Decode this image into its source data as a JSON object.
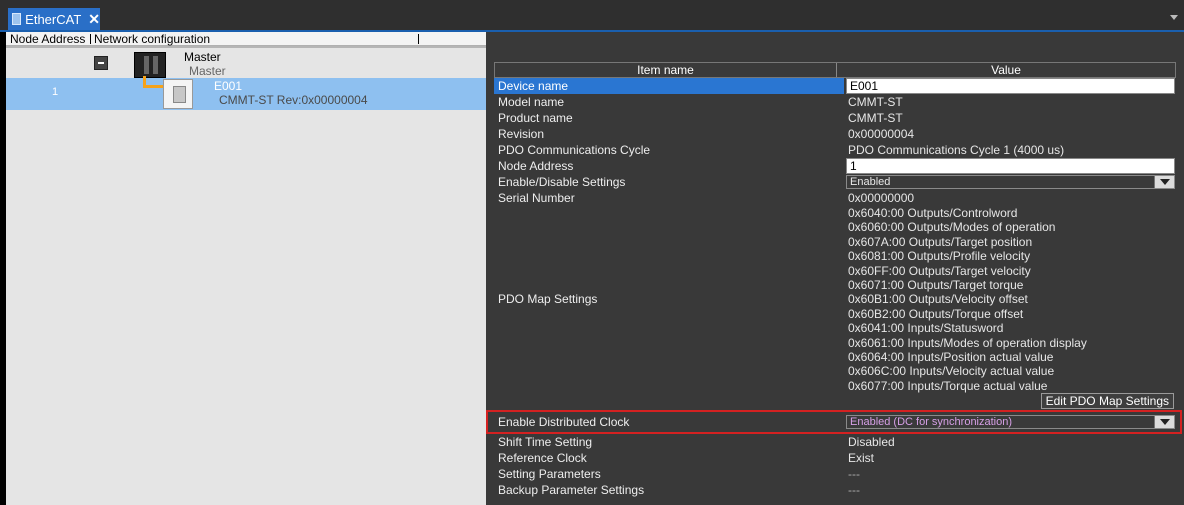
{
  "tab": {
    "title": "EtherCAT",
    "close_glyph": "✕",
    "icon": "ethercat-icon"
  },
  "tree": {
    "columns": [
      "Node Address",
      "Network configuration"
    ],
    "master": {
      "name": "Master",
      "model": "Master",
      "icon": "controller-icon",
      "toggle": "collapse"
    },
    "slave": {
      "address": "1",
      "name": "E001",
      "model": "CMMT-ST Rev:0x00000004",
      "icon": "servo-drive-icon"
    }
  },
  "props": {
    "header": {
      "item": "Item name",
      "value": "Value"
    },
    "device_name": {
      "label": "Device name",
      "value": "E001"
    },
    "model_name": {
      "label": "Model name",
      "value": "CMMT-ST"
    },
    "product_name": {
      "label": "Product name",
      "value": "CMMT-ST"
    },
    "revision": {
      "label": "Revision",
      "value": "0x00000004"
    },
    "pdo_cycle": {
      "label": "PDO Communications Cycle",
      "value": "PDO Communications Cycle 1 (4000 us)"
    },
    "node_address": {
      "label": "Node Address",
      "value": "1"
    },
    "enable_disable": {
      "label": "Enable/Disable Settings",
      "value": "Enabled"
    },
    "serial_number": {
      "label": "Serial Number",
      "value": "0x00000000"
    },
    "pdo_map": {
      "label": "PDO Map Settings",
      "entries": [
        "0x6040:00 Outputs/Controlword",
        "0x6060:00 Outputs/Modes of operation",
        "0x607A:00 Outputs/Target position",
        "0x6081:00 Outputs/Profile velocity",
        "0x60FF:00 Outputs/Target velocity",
        "0x6071:00 Outputs/Target torque",
        "0x60B1:00 Outputs/Velocity offset",
        "0x60B2:00 Outputs/Torque offset",
        "0x6041:00 Inputs/Statusword",
        "0x6061:00 Inputs/Modes of operation display",
        "0x6064:00 Inputs/Position actual value",
        "0x606C:00 Inputs/Velocity actual value",
        "0x6077:00 Inputs/Torque actual value"
      ],
      "button": "Edit PDO Map Settings"
    },
    "distributed_clock": {
      "label": "Enable Distributed Clock",
      "value": "Enabled (DC for synchronization)"
    },
    "shift_time": {
      "label": "Shift Time Setting",
      "value": "Disabled"
    },
    "reference_clock": {
      "label": "Reference Clock",
      "value": "Exist"
    },
    "setting_params": {
      "label": "Setting Parameters",
      "value": "---"
    },
    "backup_params": {
      "label": "Backup Parameter Settings",
      "value": "---"
    }
  },
  "colors": {
    "accent": "#2a76d2",
    "highlight_border": "#d42121",
    "selected_tree_row": "#8ec0f0",
    "connector": "#f5a21a"
  }
}
